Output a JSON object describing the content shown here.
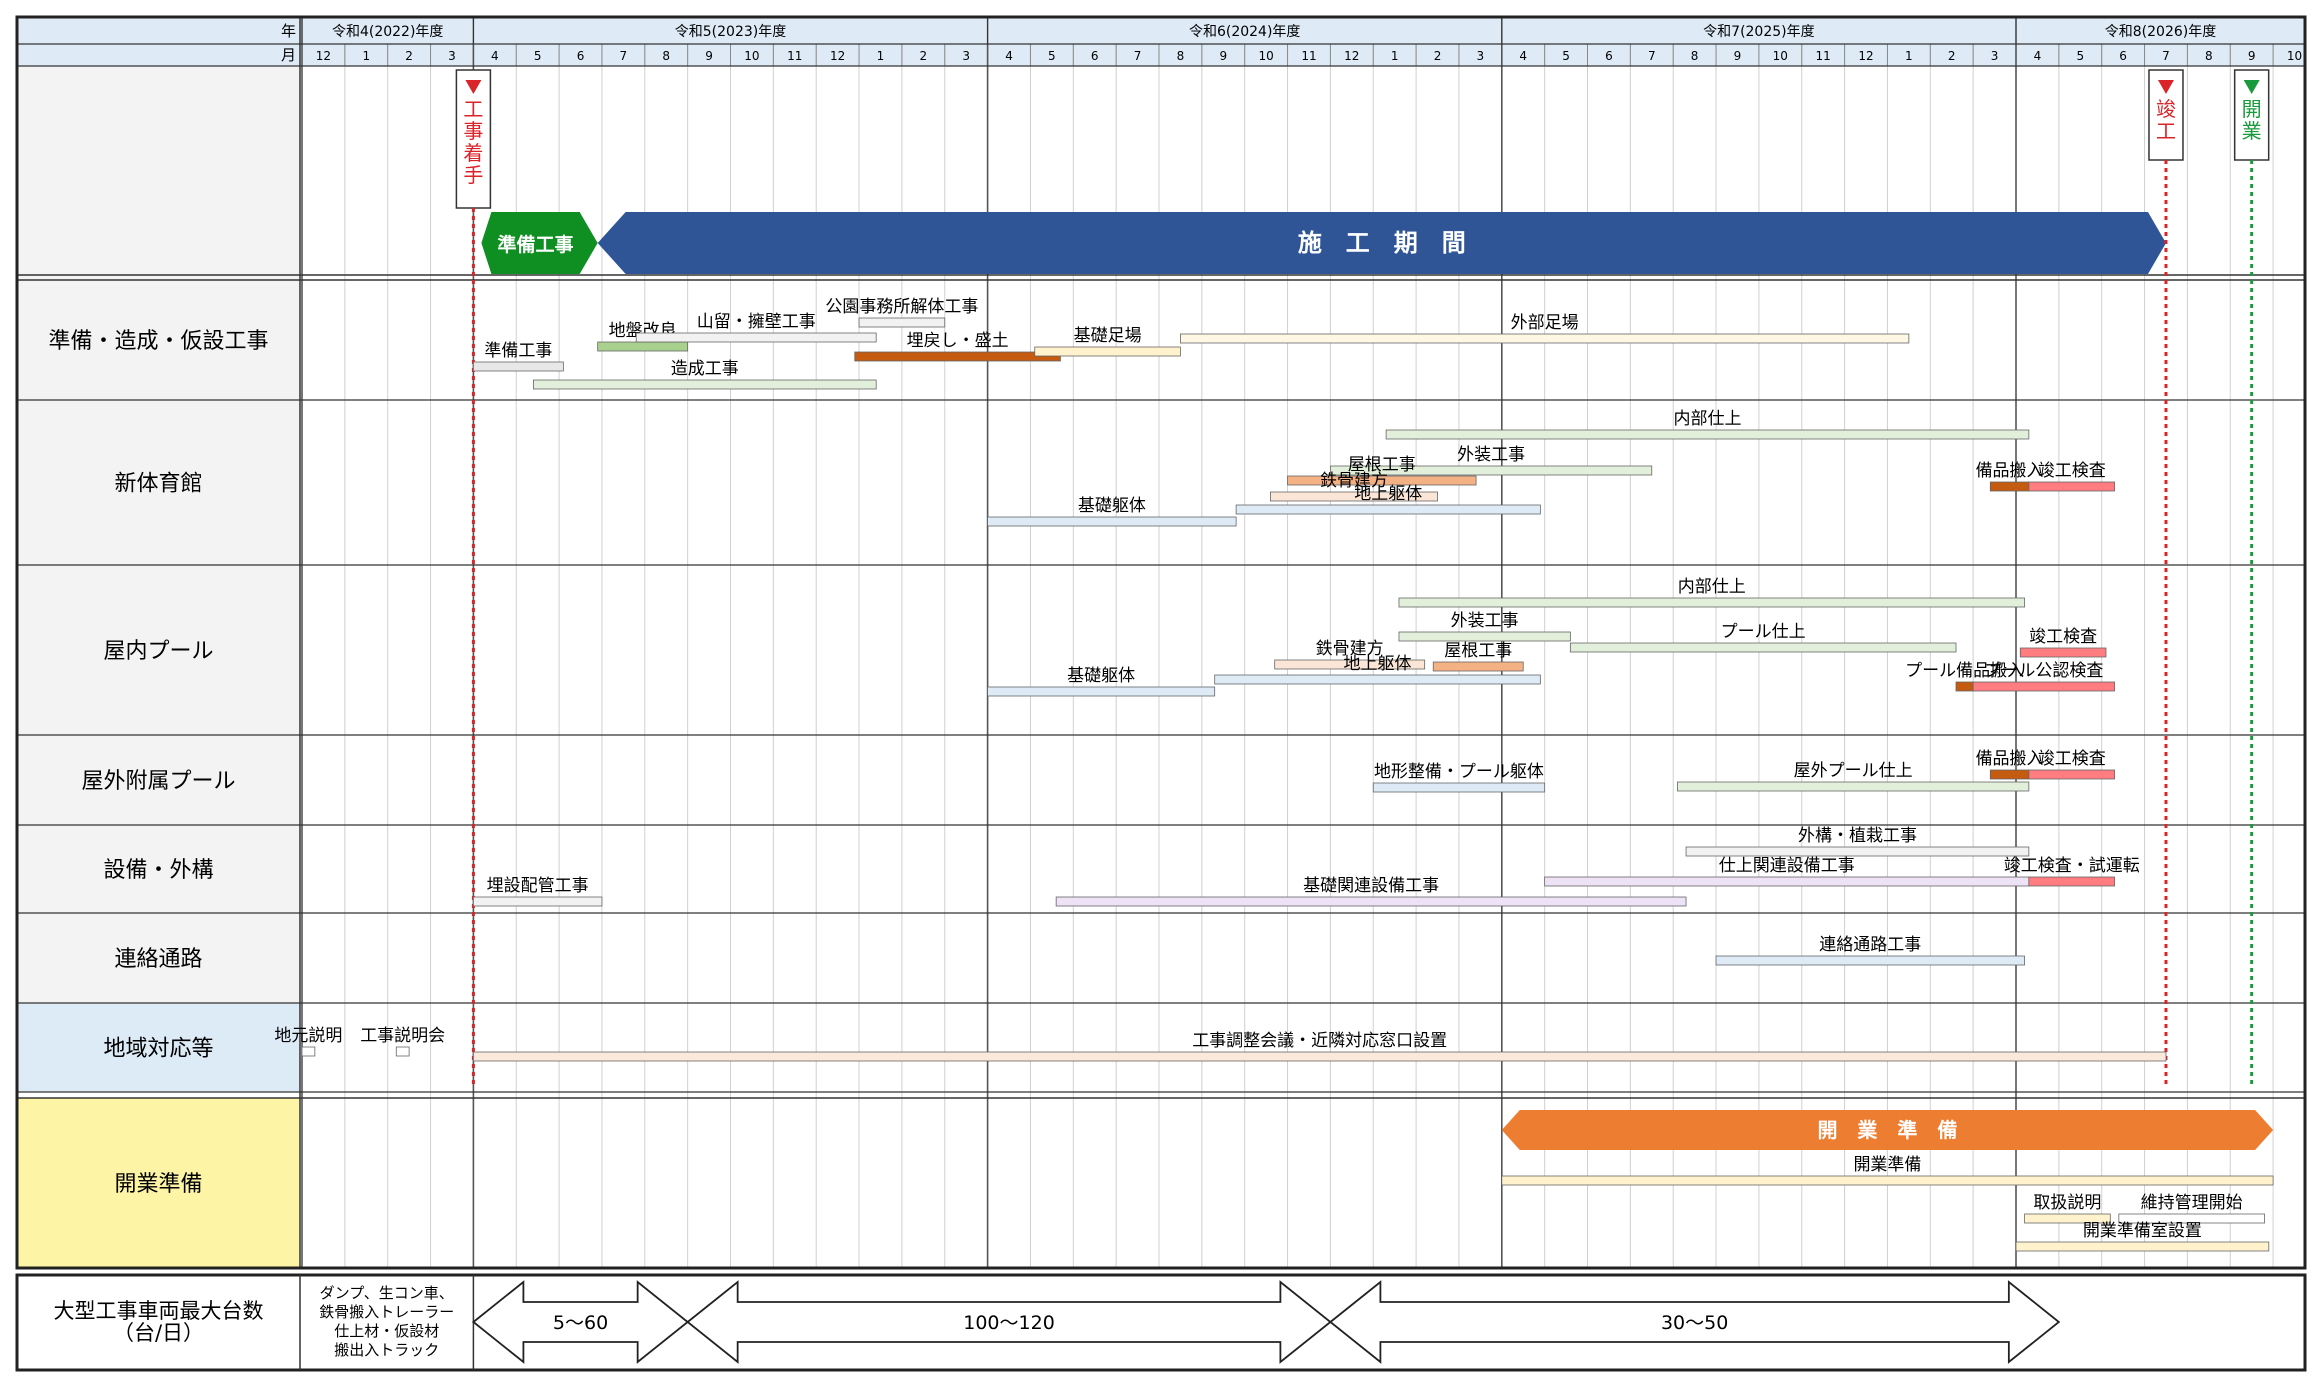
{
  "header": {
    "year_label": "年",
    "month_label": "月",
    "fiscal_years": [
      "令和4(2022)年度",
      "令和5(2023)年度",
      "令和6(2024)年度",
      "令和7(2025)年度",
      "令和8(2026)年度"
    ],
    "months": [
      "12",
      "1",
      "2",
      "3",
      "4",
      "5",
      "6",
      "7",
      "8",
      "9",
      "10",
      "11",
      "12",
      "1",
      "2",
      "3",
      "4",
      "5",
      "6",
      "7",
      "8",
      "9",
      "10",
      "11",
      "12",
      "1",
      "2",
      "3",
      "4",
      "5",
      "6",
      "7",
      "8",
      "9",
      "10",
      "11",
      "12",
      "1",
      "2",
      "3",
      "4",
      "5",
      "6",
      "7",
      "8",
      "9",
      "10"
    ]
  },
  "milestones": [
    {
      "label": "工事着手",
      "month": 4.0,
      "color": "#d9252a"
    },
    {
      "label": "竣工",
      "month": 43.5,
      "color": "#d9252a"
    },
    {
      "label": "開業",
      "month": 45.5,
      "color": "#1a9a3c"
    }
  ],
  "periods": [
    {
      "label": "準備工事",
      "start": 4.0,
      "end": 6.9,
      "color": "#0f8f22"
    },
    {
      "label": "施　工　期　間",
      "start": 6.9,
      "end": 43.5,
      "color": "#2f5597"
    }
  ],
  "sections": [
    {
      "name": "準備・造成・仮設工事",
      "bg": "#f3f3f3",
      "tasks": [
        {
          "label": "準備工事",
          "start": 4.0,
          "end": 6.1,
          "color": "#e8e8e8"
        },
        {
          "label": "地盤改良",
          "start": 6.9,
          "end": 9.0,
          "color": "#a9d18e"
        },
        {
          "label": "山留・擁壁工事",
          "start": 7.8,
          "end": 13.4,
          "color": "#f2f2f2"
        },
        {
          "label": "公園事務所解体工事",
          "start": 13.0,
          "end": 15.0,
          "color": "#f2f2f2"
        },
        {
          "label": "埋戻し・盛土",
          "start": 12.9,
          "end": 17.7,
          "color": "#c55a11"
        },
        {
          "label": "造成工事",
          "start": 5.4,
          "end": 13.4,
          "color": "#e2efda"
        },
        {
          "label": "基礎足場",
          "start": 17.1,
          "end": 20.5,
          "color": "#fff2cc"
        },
        {
          "label": "外部足場",
          "start": 20.5,
          "end": 37.5,
          "color": "#fdf7e3"
        }
      ]
    },
    {
      "name": "新体育館",
      "bg": "#f3f3f3",
      "tasks": [
        {
          "label": "内部仕上",
          "start": 25.3,
          "end": 40.3,
          "color": "#e2efda"
        },
        {
          "label": "外装工事",
          "start": 24.0,
          "end": 31.5,
          "color": "#e2efda"
        },
        {
          "label": "屋根工事",
          "start": 23.0,
          "end": 27.4,
          "color": "#f4b183"
        },
        {
          "label": "備品搬入",
          "start": 39.4,
          "end": 40.3,
          "color": "#c55a11"
        },
        {
          "label": "竣工検査",
          "start": 40.3,
          "end": 42.3,
          "color": "#ff7c80"
        },
        {
          "label": "鉄骨建方",
          "start": 22.6,
          "end": 26.5,
          "color": "#fbe5d6"
        },
        {
          "label": "地上躯体",
          "start": 21.8,
          "end": 28.9,
          "color": "#deebf7"
        },
        {
          "label": "基礎躯体",
          "start": 16.0,
          "end": 21.8,
          "color": "#deebf7"
        }
      ]
    },
    {
      "name": "屋内プール",
      "bg": "#f3f3f3",
      "tasks": [
        {
          "label": "内部仕上",
          "start": 25.6,
          "end": 40.2,
          "color": "#e2efda"
        },
        {
          "label": "外装工事",
          "start": 25.6,
          "end": 29.6,
          "color": "#e2efda"
        },
        {
          "label": "プール仕上",
          "start": 29.6,
          "end": 38.6,
          "color": "#e2efda"
        },
        {
          "label": "竣工検査",
          "start": 40.1,
          "end": 42.1,
          "color": "#ff7c80"
        },
        {
          "label": "鉄骨建方",
          "start": 22.7,
          "end": 26.2,
          "color": "#fbe5d6"
        },
        {
          "label": "屋根工事",
          "start": 26.4,
          "end": 28.5,
          "color": "#f4b183"
        },
        {
          "label": "プール備品搬入",
          "start": 38.6,
          "end": 39.0,
          "color": "#c55a11"
        },
        {
          "label": "プール公認検査",
          "start": 39.0,
          "end": 42.3,
          "color": "#ff7c80"
        },
        {
          "label": "地上躯体",
          "start": 21.3,
          "end": 28.9,
          "color": "#deebf7"
        },
        {
          "label": "基礎躯体",
          "start": 16.0,
          "end": 21.3,
          "color": "#deebf7"
        }
      ]
    },
    {
      "name": "屋外附属プール",
      "bg": "#f3f3f3",
      "tasks": [
        {
          "label": "備品搬入",
          "start": 39.4,
          "end": 40.3,
          "color": "#c55a11"
        },
        {
          "label": "竣工検査",
          "start": 40.3,
          "end": 42.3,
          "color": "#ff7c80"
        },
        {
          "label": "屋外プール仕上",
          "start": 32.1,
          "end": 40.3,
          "color": "#e2efda"
        },
        {
          "label": "地形整備・プール躯体",
          "start": 25.0,
          "end": 29.0,
          "color": "#deebf7"
        }
      ]
    },
    {
      "name": "設備・外構",
      "bg": "#f3f3f3",
      "tasks": [
        {
          "label": "外構・植栽工事",
          "start": 32.3,
          "end": 40.3,
          "color": "#f2f2f2"
        },
        {
          "label": "仕上関連設備工事",
          "start": 29.0,
          "end": 40.3,
          "color": "#ede2f6"
        },
        {
          "label": "竣工検査・試運転",
          "start": 40.3,
          "end": 42.3,
          "color": "#ff7c80"
        },
        {
          "label": "埋設配管工事",
          "start": 4.0,
          "end": 7.0,
          "color": "#f2f2f2"
        },
        {
          "label": "基礎関連設備工事",
          "start": 17.6,
          "end": 32.3,
          "color": "#ede2f6"
        }
      ]
    },
    {
      "name": "連絡通路",
      "bg": "#f3f3f3",
      "tasks": [
        {
          "label": "連絡通路工事",
          "start": 33.0,
          "end": 40.2,
          "color": "#deebf7"
        }
      ]
    },
    {
      "name": "地域対応等",
      "bg": "#ddebf7",
      "tasks": [
        {
          "label": "地元説明",
          "start": 0.0,
          "end": 0.3,
          "color": "#ffffff"
        },
        {
          "label": "工事説明会",
          "start": 2.2,
          "end": 2.5,
          "color": "#ffffff"
        },
        {
          "label": "工事調整会議・近隣対応窓口設置",
          "start": 4.0,
          "end": 43.5,
          "color": "#fbe9db"
        }
      ]
    }
  ],
  "opening": {
    "name": "開業準備",
    "bg": "#fdf4a6",
    "banner": {
      "label": "開　業　準　備",
      "start": 28.0,
      "end": 46.0,
      "color": "#ed7d31"
    },
    "tasks": [
      {
        "label": "開業準備",
        "start": 28.0,
        "end": 46.0,
        "color": "#fff2cc"
      },
      {
        "label": "取扱説明",
        "start": 40.2,
        "end": 42.2,
        "color": "#fff2cc"
      },
      {
        "label": "維持管理開始",
        "start": 42.4,
        "end": 45.8,
        "color": "#ffffff"
      },
      {
        "label": "開業準備室設置",
        "start": 40.0,
        "end": 45.9,
        "color": "#fff2cc"
      }
    ]
  },
  "vehicles": {
    "label": "大型工事車両最大台数\n（台/日）",
    "desc": "ダンプ、生コン車、\n鉄骨搬入トレーラー\n仕上材・仮設材\n搬出入トラック",
    "ranges": [
      {
        "label": "5～60",
        "start": 4.0,
        "end": 9.0
      },
      {
        "label": "100～120",
        "start": 9.0,
        "end": 24.0
      },
      {
        "label": "30～50",
        "start": 24.0,
        "end": 41.0
      }
    ]
  }
}
